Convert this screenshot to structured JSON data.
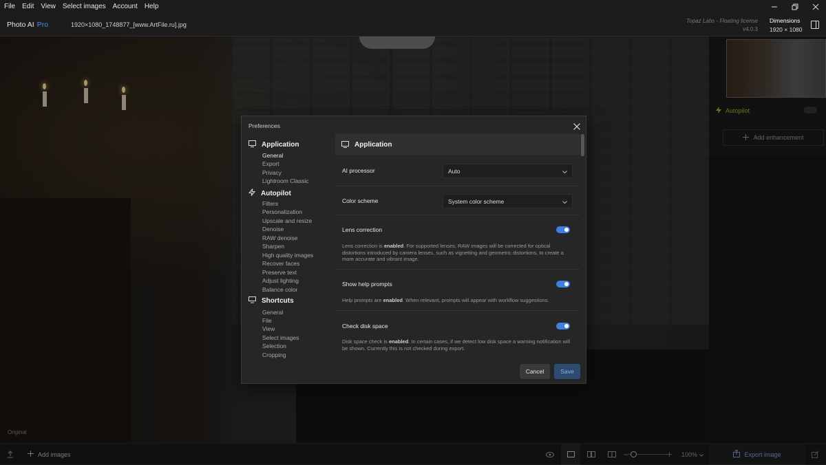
{
  "menubar": {
    "items": [
      "File",
      "Edit",
      "View",
      "Select images",
      "Account",
      "Help"
    ]
  },
  "titlebar": {
    "app_name": "Photo AI",
    "app_tier": "Pro",
    "filename": "1920×1080_1748877_[www.ArtFile.ru].jpg",
    "license_line1": "Topaz Labs - Floating license",
    "license_line2": "v4.0.3",
    "dimensions_label": "Dimensions",
    "dimensions_value": "1920 × 1080"
  },
  "canvas": {
    "view_label": "Original"
  },
  "right_panel": {
    "autopilot_label": "Autopilot",
    "add_enhancement_label": "Add enhancement"
  },
  "bottombar": {
    "add_images_label": "Add images",
    "zoom_value": "100%",
    "export_label": "Export image"
  },
  "dialog": {
    "title": "Preferences",
    "nav": {
      "application": {
        "label": "Application",
        "items": [
          "General",
          "Export",
          "Privacy",
          "Lightroom Classic"
        ]
      },
      "autopilot": {
        "label": "Autopilot",
        "items": [
          "Filters",
          "Personalization",
          "Upscale and resize",
          "Denoise",
          "RAW denoise",
          "Sharpen",
          "High quality images",
          "Recover faces",
          "Preserve text",
          "Adjust lighting",
          "Balance color"
        ]
      },
      "shortcuts": {
        "label": "Shortcuts",
        "items": [
          "General",
          "File",
          "View",
          "Select images",
          "Selection",
          "Cropping"
        ]
      }
    },
    "content": {
      "header": "Application",
      "ai_processor": {
        "label": "AI processor",
        "value": "Auto"
      },
      "color_scheme": {
        "label": "Color scheme",
        "value": "System color scheme"
      },
      "lens_correction": {
        "label": "Lens correction",
        "enabled": true,
        "desc_pre": "Lens correction is ",
        "desc_bold": "enabled",
        "desc_post": ". For supported lenses, RAW images will be corrected for optical distortions introduced by camera lenses, such as vignetting and geometric distortions, to create a more accurate and vibrant image."
      },
      "help_prompts": {
        "label": "Show help prompts",
        "enabled": true,
        "desc_pre": "Help prompts are ",
        "desc_bold": "enabled",
        "desc_post": ". When relevant, prompts will appear with workflow suggestions."
      },
      "disk_space": {
        "label": "Check disk space",
        "enabled": true,
        "desc_pre": "Disk space check is ",
        "desc_bold": "enabled",
        "desc_post": ". In certain cases, if we detect low disk space a warning notification will be shown. Currently this is not checked during export."
      }
    },
    "buttons": {
      "cancel": "Cancel",
      "save": "Save"
    }
  },
  "colors": {
    "accent": "#3f7fe0",
    "autopilot": "#8fbf3f",
    "pro": "#4a8fe4"
  }
}
